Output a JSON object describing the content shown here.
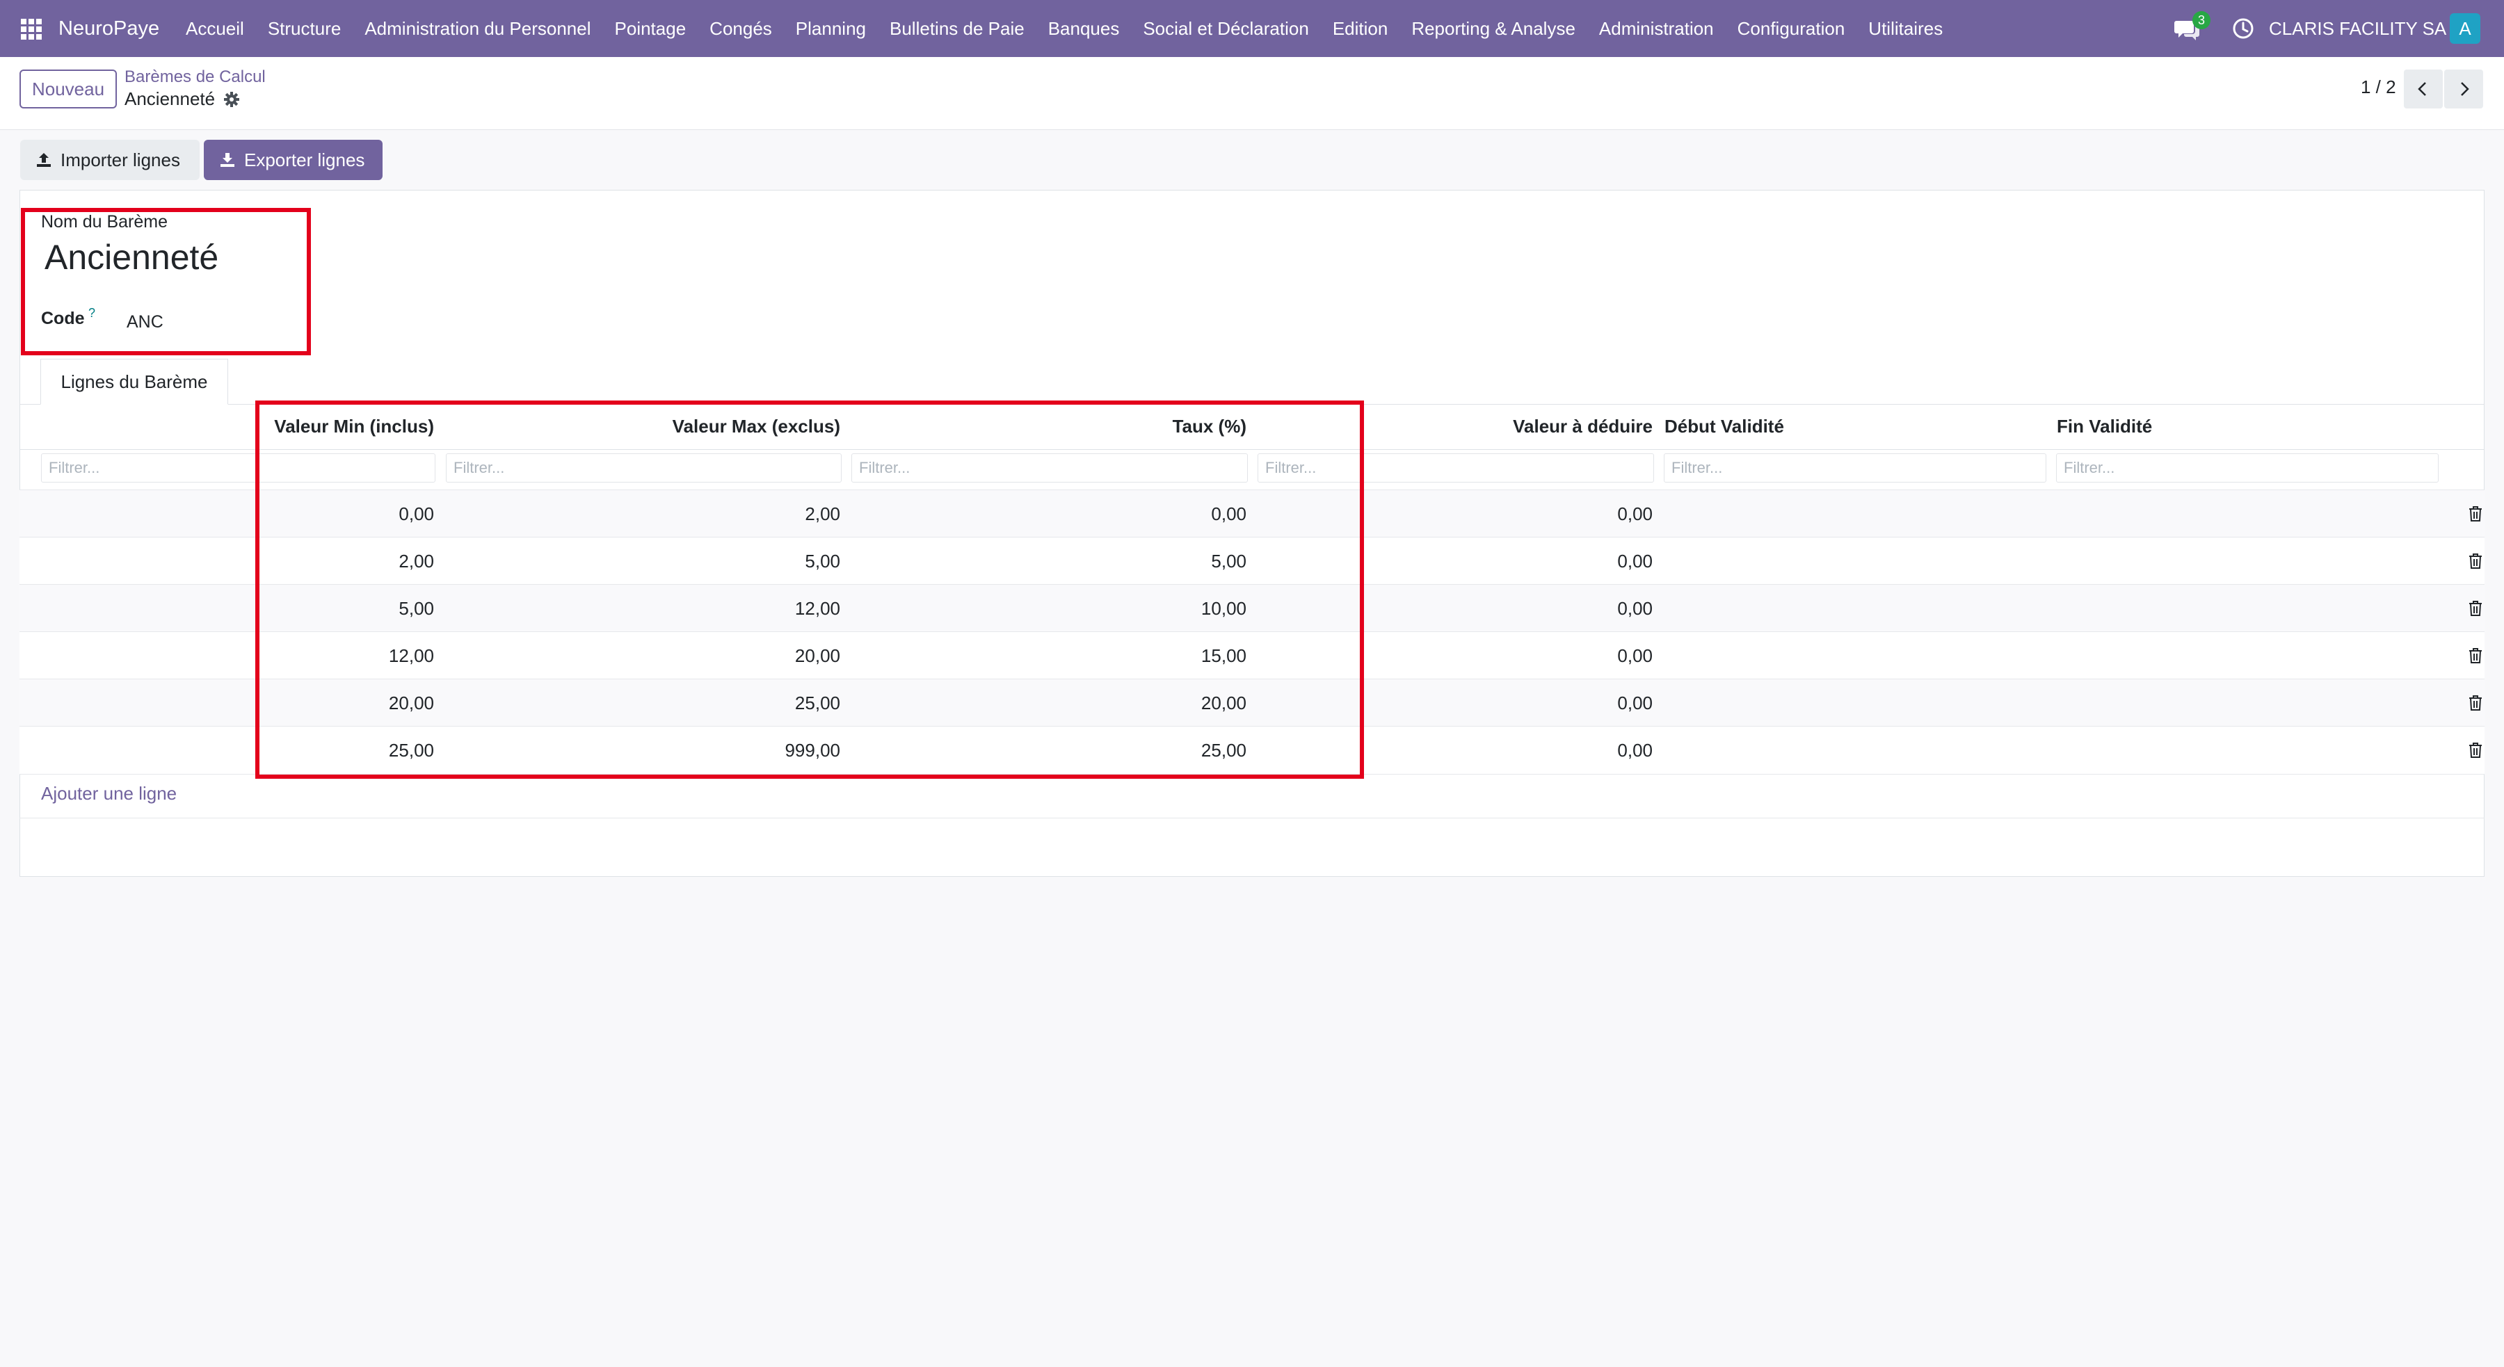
{
  "navbar": {
    "brand": "NeuroPaye",
    "menu": [
      "Accueil",
      "Structure",
      "Administration du Personnel",
      "Pointage",
      "Congés",
      "Planning",
      "Bulletins de Paie",
      "Banques",
      "Social et Déclaration",
      "Edition",
      "Reporting & Analyse",
      "Administration",
      "Configuration",
      "Utilitaires"
    ],
    "chat_count": "3",
    "company": "CLARIS FACILITY SA",
    "avatar_letter": "A",
    "accent": "#71639e"
  },
  "control": {
    "new_label": "Nouveau",
    "breadcrumb_parent": "Barèmes de Calcul",
    "breadcrumb_current": "Ancienneté",
    "pager": "1 / 2"
  },
  "actions": {
    "import_label": "Importer lignes",
    "export_label": "Exporter lignes"
  },
  "form": {
    "name_label": "Nom du Barème",
    "name_value": "Ancienneté",
    "code_label": "Code",
    "code_help": "?",
    "code_value": "ANC"
  },
  "tab": {
    "label": "Lignes du Barème"
  },
  "table": {
    "columns": [
      "Valeur Min (inclus)",
      "Valeur Max (exclus)",
      "Taux (%)",
      "Valeur à déduire",
      "Début Validité",
      "Fin Validité"
    ],
    "filter_placeholder": "Filtrer...",
    "rows": [
      [
        "0,00",
        "2,00",
        "0,00",
        "0,00"
      ],
      [
        "2,00",
        "5,00",
        "5,00",
        "0,00"
      ],
      [
        "5,00",
        "12,00",
        "10,00",
        "0,00"
      ],
      [
        "12,00",
        "20,00",
        "15,00",
        "0,00"
      ],
      [
        "20,00",
        "25,00",
        "20,00",
        "0,00"
      ],
      [
        "25,00",
        "999,00",
        "25,00",
        "0,00"
      ]
    ],
    "add_line": "Ajouter une ligne"
  }
}
